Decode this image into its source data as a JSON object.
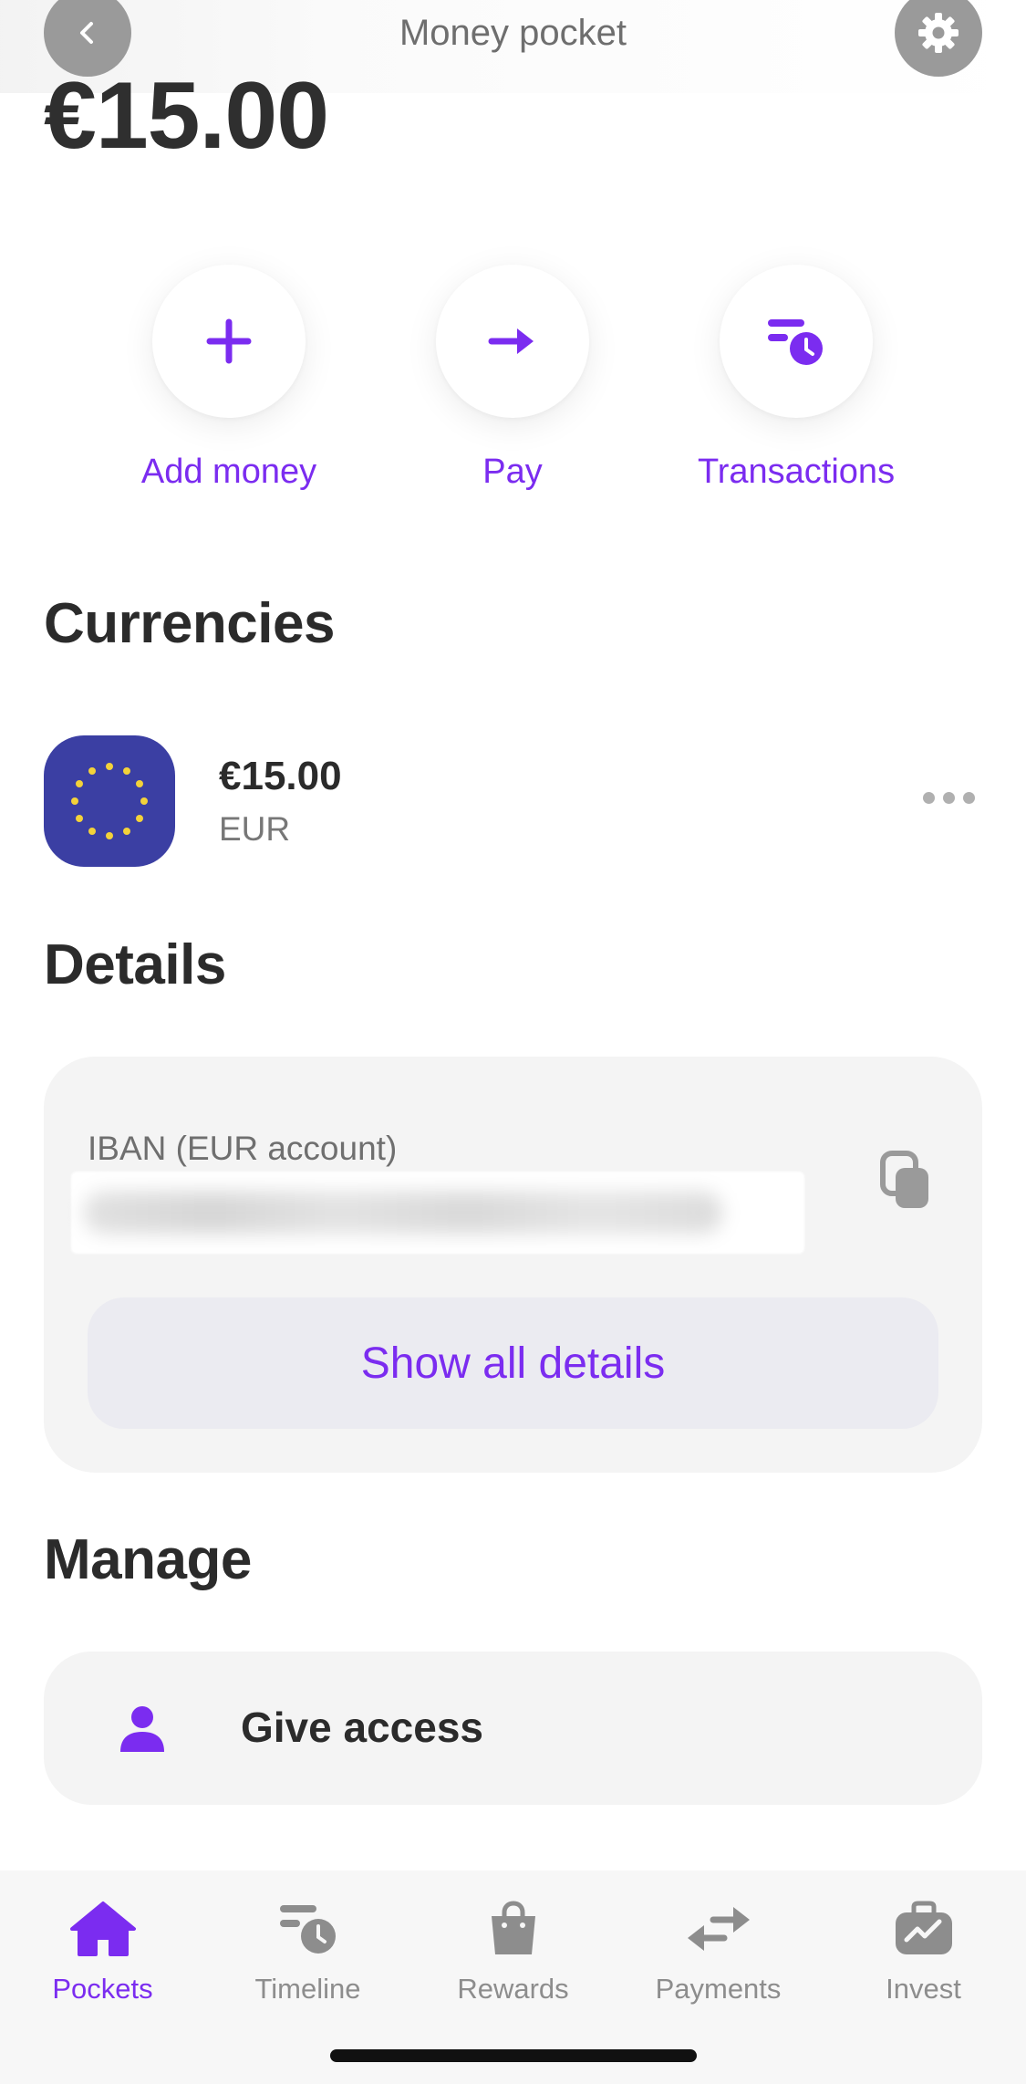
{
  "header": {
    "title": "Money pocket"
  },
  "balance": "€15.00",
  "actions": [
    {
      "label": "Add money"
    },
    {
      "label": "Pay"
    },
    {
      "label": "Transactions"
    }
  ],
  "sections": {
    "currencies": "Currencies",
    "details": "Details",
    "manage": "Manage"
  },
  "currency": {
    "amount": "€15.00",
    "code": "EUR"
  },
  "details": {
    "iban_label": "IBAN (EUR account)",
    "show_all_label": "Show all details"
  },
  "manage": {
    "give_access_label": "Give access"
  },
  "tabs": [
    {
      "label": "Pockets",
      "icon": "home-icon",
      "active": true
    },
    {
      "label": "Timeline",
      "icon": "timeline-icon",
      "active": false
    },
    {
      "label": "Rewards",
      "icon": "shopping-bag-icon",
      "active": false
    },
    {
      "label": "Payments",
      "icon": "transfer-arrows-icon",
      "active": false
    },
    {
      "label": "Invest",
      "icon": "briefcase-chart-icon",
      "active": false
    }
  ],
  "colors": {
    "accent": "#7b2cf0",
    "eu_blue": "#3b3fa3",
    "eu_star": "#f3d23a"
  }
}
